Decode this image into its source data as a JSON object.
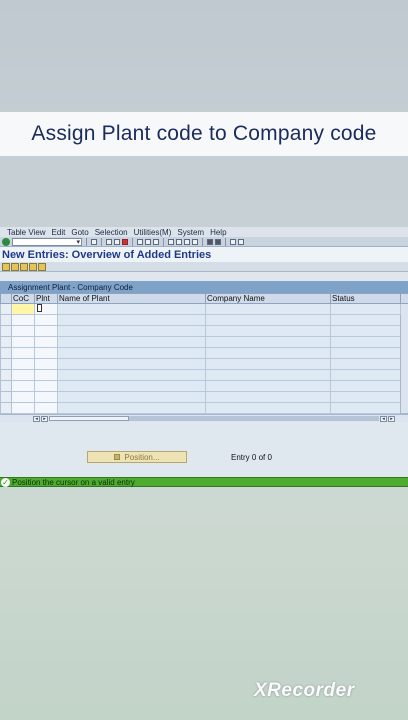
{
  "video_title": "Assign Plant code  to Company code",
  "menu": [
    "Table View",
    "Edit",
    "Goto",
    "Selection",
    "Utilities(M)",
    "System",
    "Help"
  ],
  "screen_title": "New Entries: Overview of Added Entries",
  "table": {
    "caption": "Assignment Plant - Company Code",
    "columns": [
      "CoC",
      "Plnt",
      "Name of Plant",
      "Company Name",
      "Status"
    ]
  },
  "position_button": "Position...",
  "entry_text": "Entry 0 of 0",
  "status_message": "Position the cursor on a valid entry",
  "watermark": "XRecorder",
  "colors": {
    "status_bar": "#4faa30",
    "title_text": "#1b2c5a",
    "screen_title": "#1f3a88",
    "active_cell": "#fff6a8"
  }
}
